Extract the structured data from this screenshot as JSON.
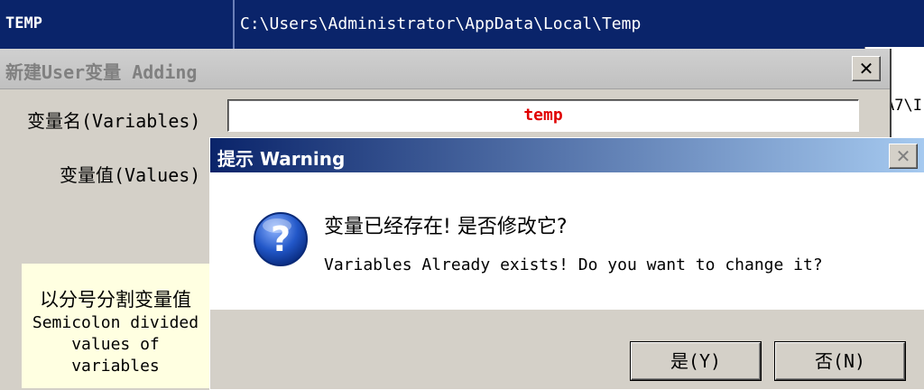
{
  "bg_row": {
    "name": "TEMP",
    "value": "C:\\Users\\Administrator\\AppData\\Local\\Temp"
  },
  "bg_fragment": "A7\\I",
  "add_dialog": {
    "title": "新建User变量 Adding",
    "close_glyph": "✕",
    "name_label": "变量名(Variables)",
    "value_label": "变量值(Values)",
    "name_value": "temp",
    "hint_zh": "以分号分割变量值",
    "hint_en_1": "Semicolon divided",
    "hint_en_2": "values of",
    "hint_en_3": "variables"
  },
  "warning": {
    "title": "提示 Warning",
    "close_glyph": "✕",
    "icon": "question-icon",
    "message_zh": "变量已经存在! 是否修改它?",
    "message_en": "Variables Already exists! Do you want to change it?",
    "yes_label": "是(Y)",
    "no_label": "否(N)"
  },
  "colors": {
    "title_active": "#0a246a",
    "value_text": "#e00000",
    "hint_bg": "#ffffe1"
  }
}
